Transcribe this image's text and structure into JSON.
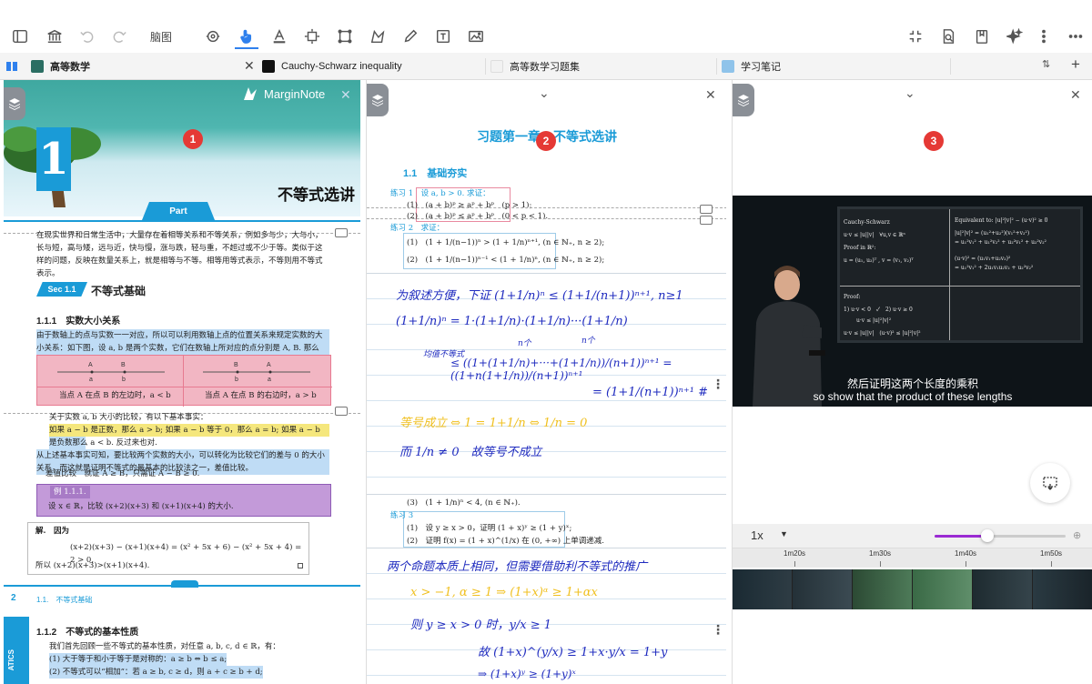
{
  "toolbar": {
    "mindmap_label": "脑图",
    "icons": [
      "sidebar-icon",
      "library-icon",
      "undo-icon",
      "redo-icon",
      "lasso-icon",
      "pointer-hand-icon",
      "text-highlight-icon",
      "crop-select-icon",
      "rect-select-icon",
      "shape-icon",
      "pen-icon",
      "textbox-icon",
      "image-icon",
      "fullscreen-exit-icon",
      "search-doc-icon",
      "bookmark-icon",
      "ai-sparkle-icon",
      "more-vertical-icon",
      "more-horizontal-icon"
    ]
  },
  "tabs": [
    {
      "label": "高等数学"
    },
    {
      "label": "Cauchy-Schwarz inequality"
    },
    {
      "label": "高等数学习题集"
    },
    {
      "label": "学习笔记"
    }
  ],
  "badges": [
    "1",
    "2",
    "3"
  ],
  "panel1": {
    "logo": "MarginNote",
    "chapter_number": "1",
    "chapter_title": "不等式选讲",
    "part_label": "Part",
    "intro": "在现实世界和日常生活中，大量存在着相等关系和不等关系，例如多与少，大与小，长与短，高与矮，远与近，快与慢，涨与跌，轻与重，不超过或不少于等。类似于这样的问题，反映在数量关系上，就是相等与不等。相等用等式表示，不等则用不等式表示。",
    "sec_tag": "Sec 1.1",
    "sec_title": "不等式基础",
    "h_111": "1.1.1　实数大小关系",
    "para_111": "由于数轴上的点与实数一一对应，所以可以利用数轴上点的位置关系来规定实数的大小关系：如下图，设 a, b 是两个实数，它们在数轴上所对应的点分别是 A, B. 那么",
    "box_left": "当点 A 在点 B 的左边时，a < b",
    "box_right": "当点 A 在点 B 的右边时，a > b",
    "para2": "关于实数 a, b 大小的比较，有以下基本事实：",
    "para2b": "如果 a − b 是正数，那么 a > b; 如果 a − b 等于 0，那么 a = b; 如果 a − b 是负数那么 a < b. 反过来也对.",
    "para3": "从上述基本事实可知，要比较两个实数的大小，可以转化为比较它们的差与 0 的大小关系，而这就是证明不等式的最基本的比较法之一，差值比较。",
    "para3b": "差值比较　就证 A ≥ B，只需证 A − B ≥ 0.",
    "example_title": "例 1.1.1.",
    "example": "设 x ∈ ℝ，比较 (x+2)(x+3) 和 (x+1)(x+4) 的大小.",
    "solution_label": "解.　因为",
    "solution_eq": "(x+2)(x+3) − (x+1)(x+4) = (x² + 5x + 6) − (x² + 5x + 4) = 2 > 0,",
    "solution_end": "所以 (x+2)(x+3)>(x+1)(x+4).",
    "footer_page": "2",
    "footer_sec": "1.1.　不等式基础",
    "h_112": "1.1.2　不等式的基本性质",
    "para_112": "我们首先回顾一些不等式的基本性质，对任意 a, b, c, d ∈ ℝ，有：",
    "prop1": "(1) 大于等于和小于等于是对称的：a ≥ b ⇔ b ≤ a;",
    "prop2": "(2) 不等式可以“相加”：若 a ≥ b, c ≥ d，则 a + c ≥ b + d;",
    "side_label": "ATICS"
  },
  "panel2": {
    "title": "习题第一章　不等式选讲",
    "subtitle": "1.1　基础夯实",
    "ex1_head": "练习 1　设 a, b > 0. 求证：",
    "ex1_1": "(1)　(a + b)ᵖ ≥ aᵖ + bᵖ　(p > 1);",
    "ex1_2": "(2)　(a + b)ᵖ ≤ aᵖ + bᵖ　(0 < p < 1).",
    "ex2_head": "练习 2　求证：",
    "ex2_1": "(1)　(1 + 1/(n−1))ⁿ > (1 + 1/n)ⁿ⁺¹, (n ∈ ℕ₊, n ≥ 2);",
    "ex2_2": "(2)　(1 + 1/(n−1))ⁿ⁻¹ < (1 + 1/n)ⁿ, (n ∈ ℕ₊, n ≥ 2);",
    "hw1": "为叙述方便，下证 (1+1/n)ⁿ ≤ (1+1/(n+1))ⁿ⁺¹, n≥1",
    "hw2": "(1+1/n)ⁿ = 1·(1+1/n)·(1+1/n)···(1+1/n)",
    "hw_n1": "n个",
    "hw_n2": "n个",
    "hw3_label": "均值不等式",
    "hw3": "≤ ((1+(1+1/n)+···+(1+1/n))/(n+1))ⁿ⁺¹ = ((1+n(1+1/n))/(n+1))ⁿ⁺¹",
    "hw4": "= (1+1/(n+1))ⁿ⁺¹ #",
    "hw5": "等号成立 ⇔ 1 = 1+1/n ⇔ 1/n = 0",
    "hw6": "而 1/n ≠ 0　故等号不成立",
    "ex2_3": "(3)　(1 + 1/n)ⁿ < 4, (n ∈ ℕ₊).",
    "ex3_head": "练习 3",
    "ex3_1": "(1)　设 y ≥ x > 0，证明 (1 + x)ʸ ≥ (1 + y)ˣ;",
    "ex3_2": "(2)　证明 f(x) = (1 + x)^(1/x) 在 (0, +∞) 上单调递减.",
    "hw7": "两个命题本质上相同，但需要借助利不等式的推广",
    "hw8": "x > −1, α ≥ 1 ⇒ (1+x)ᵅ ≥ 1+αx",
    "hw9": "则 y ≥ x > 0 时，y/x ≥ 1",
    "hw10": "故 (1+x)^(y/x) ≥ 1+x·y/x = 1+y",
    "hw11": "⇒ (1+x)ʸ ≥ (1+y)ˣ"
  },
  "panel3": {
    "board": {
      "title": "Cauchy-Schwarz",
      "line1": "u·v ≤ |u||v|　∀u,v ∈ ℝⁿ",
      "line2": "Proof in ℝ²:",
      "line3": "u = (u₁, u₂)ᵀ ,  v = (v₁, v₂)ᵀ",
      "right1": "Equivalent to: |u|²|v|² − (u·v)² ≥ 0",
      "right2": "|u|²|v|² = (u₁²+u₂²)(v₁²+v₂²)",
      "right3": "= u₁²v₁² + u₁²v₂² + u₂²v₁² + u₂²v₂²",
      "right4": "(u·v)² = (u₁v₁+u₂v₂)²",
      "right5": "= u₁²v₁² + 2u₁v₁u₂v₂ + u₂²v₂²",
      "proof": "Proof:",
      "p1": "1) u·v < 0　✓　2) u·v ≥ 0",
      "p2": "u·v ≤ |u|²|v|²",
      "p3": "u·v ≤ |u||v|　(u·v)² ≤ |u|²|v|²"
    },
    "subtitle_zh": "然后证明这两个长度的乘积",
    "subtitle_en": "so show that the product of these lengths",
    "speed": "1x",
    "speed_arrow": "▼",
    "progress": 0.4,
    "zoom_icon": "⊕",
    "time_ticks": [
      "1m20s",
      "1m30s",
      "1m40s",
      "1m50s"
    ]
  }
}
